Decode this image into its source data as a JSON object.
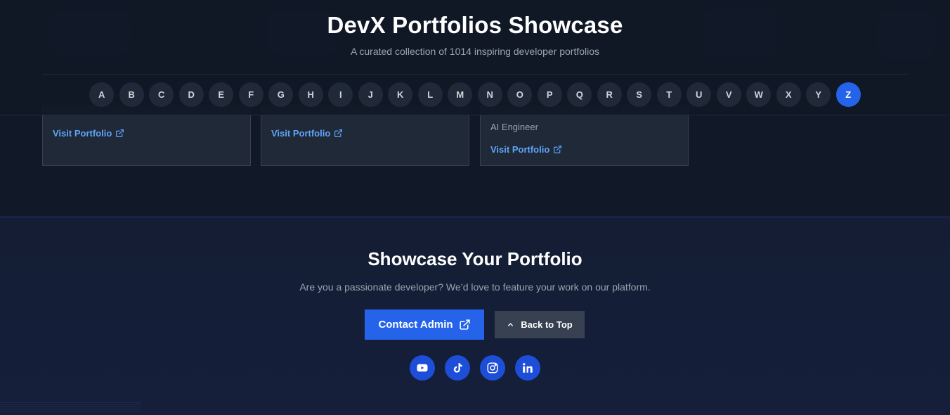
{
  "header": {
    "title": "DevX Portfolios Showcase",
    "subtitle": "A curated collection of 1014 inspiring developer portfolios"
  },
  "alphabet": {
    "letters": [
      "A",
      "B",
      "C",
      "D",
      "E",
      "F",
      "G",
      "H",
      "I",
      "J",
      "K",
      "L",
      "M",
      "N",
      "O",
      "P",
      "Q",
      "R",
      "S",
      "T",
      "U",
      "V",
      "W",
      "X",
      "Y",
      "Z"
    ],
    "active": "Z"
  },
  "cards": [
    {
      "role": "",
      "link_label": "Visit Portfolio"
    },
    {
      "role": "",
      "link_label": "Visit Portfolio"
    },
    {
      "role": "AI Engineer",
      "link_label": "Visit Portfolio"
    }
  ],
  "footer": {
    "title": "Showcase Your Portfolio",
    "subtitle": "Are you a passionate developer? We’d love to feature your work on our platform.",
    "contact_label": "Contact Admin",
    "top_label": "Back to Top",
    "socials": [
      "youtube-icon",
      "tiktok-icon",
      "instagram-icon",
      "linkedin-icon"
    ]
  },
  "colors": {
    "accent": "#2563eb",
    "link": "#60a5fa",
    "background": "#111827"
  }
}
